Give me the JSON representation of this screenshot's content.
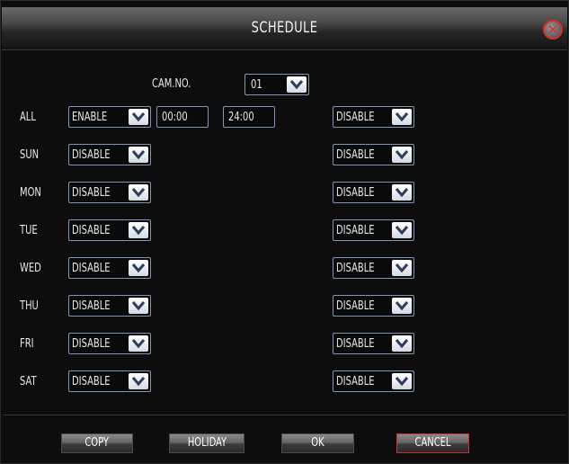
{
  "title": "SCHEDULE",
  "cam": {
    "label": "CAM.NO.",
    "value": "01"
  },
  "all_row": {
    "label": "ALL",
    "mode": "ENABLE",
    "start": "00:00",
    "end": "24:00",
    "mode2": "DISABLE"
  },
  "days": [
    {
      "label": "SUN",
      "mode": "DISABLE",
      "mode2": "DISABLE"
    },
    {
      "label": "MON",
      "mode": "DISABLE",
      "mode2": "DISABLE"
    },
    {
      "label": "TUE",
      "mode": "DISABLE",
      "mode2": "DISABLE"
    },
    {
      "label": "WED",
      "mode": "DISABLE",
      "mode2": "DISABLE"
    },
    {
      "label": "THU",
      "mode": "DISABLE",
      "mode2": "DISABLE"
    },
    {
      "label": "FRI",
      "mode": "DISABLE",
      "mode2": "DISABLE"
    },
    {
      "label": "SAT",
      "mode": "DISABLE",
      "mode2": "DISABLE"
    }
  ],
  "buttons": {
    "copy": "COPY",
    "holiday": "HOLIDAY",
    "ok": "OK",
    "cancel": "CANCEL"
  },
  "icons": {
    "close": "close-icon",
    "dropdown": "chevron-down-icon"
  },
  "colors": {
    "background": "#0d0d0d",
    "field_border": "#7e96b8",
    "close_accent": "#e12a2a",
    "cancel_border": "#c83030"
  }
}
